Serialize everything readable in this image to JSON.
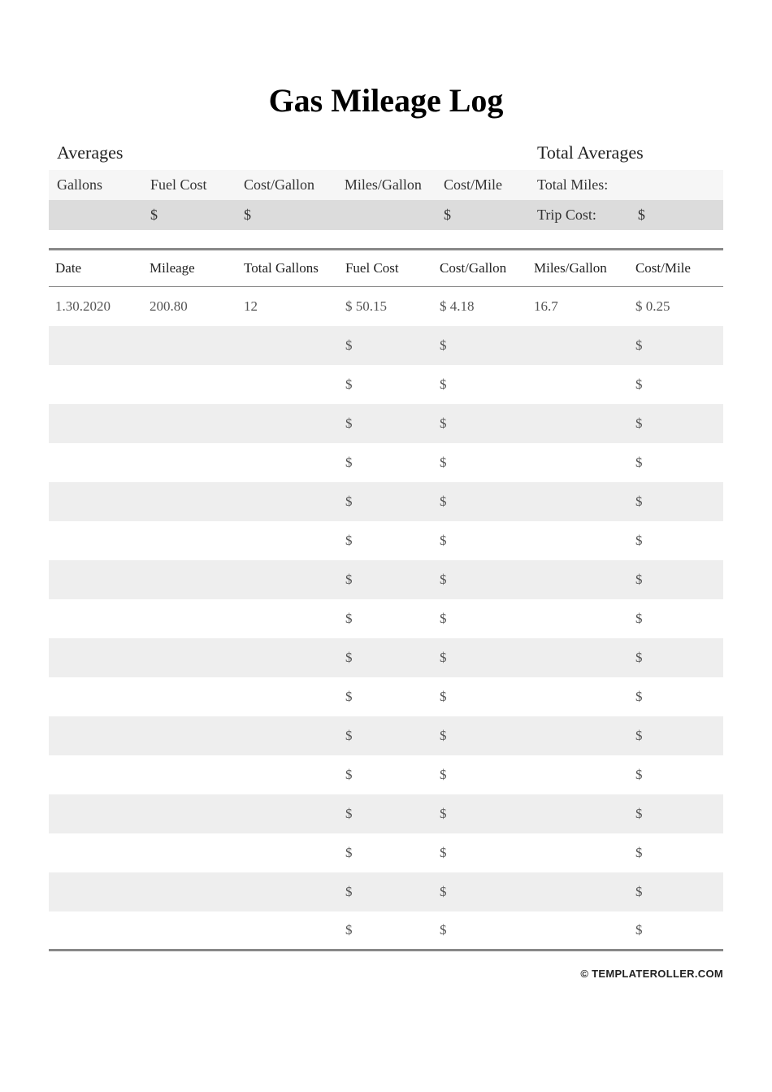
{
  "title": "Gas Mileage Log",
  "averages": {
    "section_label": "Averages",
    "total_section_label": "Total Averages",
    "headers": {
      "gallons": "Gallons",
      "fuel_cost": "Fuel Cost",
      "cost_gallon": "Cost/Gallon",
      "miles_gallon": "Miles/Gallon",
      "cost_mile": "Cost/Mile",
      "total_miles": "Total Miles:",
      "trip_cost": "Trip Cost:"
    },
    "values": {
      "gallons": "",
      "fuel_cost": "$",
      "cost_gallon": "$",
      "miles_gallon": "",
      "cost_mile": "$",
      "total_miles": "",
      "trip_cost": "$"
    }
  },
  "log": {
    "headers": {
      "date": "Date",
      "mileage": "Mileage",
      "total_gallons": "Total Gallons",
      "fuel_cost": "Fuel Cost",
      "cost_gallon": "Cost/Gallon",
      "miles_gallon": "Miles/Gallon",
      "cost_mile": "Cost/Mile"
    },
    "rows": [
      {
        "date": "1.30.2020",
        "mileage": "200.80",
        "total_gallons": "12",
        "fuel_cost": "$ 50.15",
        "cost_gallon": "$ 4.18",
        "miles_gallon": "16.7",
        "cost_mile": "$ 0.25"
      },
      {
        "date": "",
        "mileage": "",
        "total_gallons": "",
        "fuel_cost": "$",
        "cost_gallon": "$",
        "miles_gallon": "",
        "cost_mile": "$"
      },
      {
        "date": "",
        "mileage": "",
        "total_gallons": "",
        "fuel_cost": "$",
        "cost_gallon": "$",
        "miles_gallon": "",
        "cost_mile": "$"
      },
      {
        "date": "",
        "mileage": "",
        "total_gallons": "",
        "fuel_cost": "$",
        "cost_gallon": "$",
        "miles_gallon": "",
        "cost_mile": "$"
      },
      {
        "date": "",
        "mileage": "",
        "total_gallons": "",
        "fuel_cost": "$",
        "cost_gallon": "$",
        "miles_gallon": "",
        "cost_mile": "$"
      },
      {
        "date": "",
        "mileage": "",
        "total_gallons": "",
        "fuel_cost": "$",
        "cost_gallon": "$",
        "miles_gallon": "",
        "cost_mile": "$"
      },
      {
        "date": "",
        "mileage": "",
        "total_gallons": "",
        "fuel_cost": "$",
        "cost_gallon": "$",
        "miles_gallon": "",
        "cost_mile": "$"
      },
      {
        "date": "",
        "mileage": "",
        "total_gallons": "",
        "fuel_cost": "$",
        "cost_gallon": "$",
        "miles_gallon": "",
        "cost_mile": "$"
      },
      {
        "date": "",
        "mileage": "",
        "total_gallons": "",
        "fuel_cost": "$",
        "cost_gallon": "$",
        "miles_gallon": "",
        "cost_mile": "$"
      },
      {
        "date": "",
        "mileage": "",
        "total_gallons": "",
        "fuel_cost": "$",
        "cost_gallon": "$",
        "miles_gallon": "",
        "cost_mile": "$"
      },
      {
        "date": "",
        "mileage": "",
        "total_gallons": "",
        "fuel_cost": "$",
        "cost_gallon": "$",
        "miles_gallon": "",
        "cost_mile": "$"
      },
      {
        "date": "",
        "mileage": "",
        "total_gallons": "",
        "fuel_cost": "$",
        "cost_gallon": "$",
        "miles_gallon": "",
        "cost_mile": "$"
      },
      {
        "date": "",
        "mileage": "",
        "total_gallons": "",
        "fuel_cost": "$",
        "cost_gallon": "$",
        "miles_gallon": "",
        "cost_mile": "$"
      },
      {
        "date": "",
        "mileage": "",
        "total_gallons": "",
        "fuel_cost": "$",
        "cost_gallon": "$",
        "miles_gallon": "",
        "cost_mile": "$"
      },
      {
        "date": "",
        "mileage": "",
        "total_gallons": "",
        "fuel_cost": "$",
        "cost_gallon": "$",
        "miles_gallon": "",
        "cost_mile": "$"
      },
      {
        "date": "",
        "mileage": "",
        "total_gallons": "",
        "fuel_cost": "$",
        "cost_gallon": "$",
        "miles_gallon": "",
        "cost_mile": "$"
      },
      {
        "date": "",
        "mileage": "",
        "total_gallons": "",
        "fuel_cost": "$",
        "cost_gallon": "$",
        "miles_gallon": "",
        "cost_mile": "$"
      }
    ]
  },
  "footer": "© TEMPLATEROLLER.COM"
}
